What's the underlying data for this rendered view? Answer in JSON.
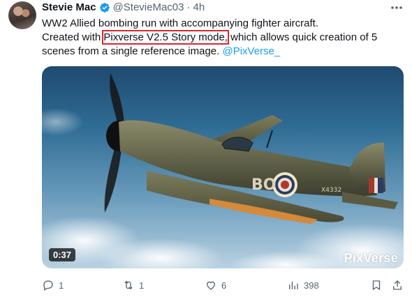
{
  "author": {
    "name": "Stevie Mac",
    "handle": "@StevieMac03",
    "separator": "·",
    "time": "4h"
  },
  "tweet": {
    "line1": "WW2 Allied bombing run with accompanying fighter aircraft.",
    "line2_pre": "Created with ",
    "line2_highlight": "Pixverse V2.5 Story mode,",
    "line2_post": " which allows quick creation of 5",
    "line3_pre": "scenes from a single reference image. ",
    "mention": "@PixVerse_"
  },
  "media": {
    "duration": "0:37",
    "watermark": "PixVerse",
    "roundel": "BO",
    "serial": "X4332"
  },
  "actions": {
    "replies": "1",
    "reposts": "1",
    "likes": "6",
    "views": "398"
  },
  "icons": {
    "verified": "verified-badge-icon",
    "more": "more-icon",
    "reply": "reply-icon",
    "repost": "repost-icon",
    "like": "heart-icon",
    "views": "views-icon",
    "bookmark": "bookmark-icon",
    "share": "share-icon"
  },
  "colors": {
    "accent": "#1d9bf0",
    "highlight_box": "#e0242c",
    "muted_text": "#536471"
  }
}
